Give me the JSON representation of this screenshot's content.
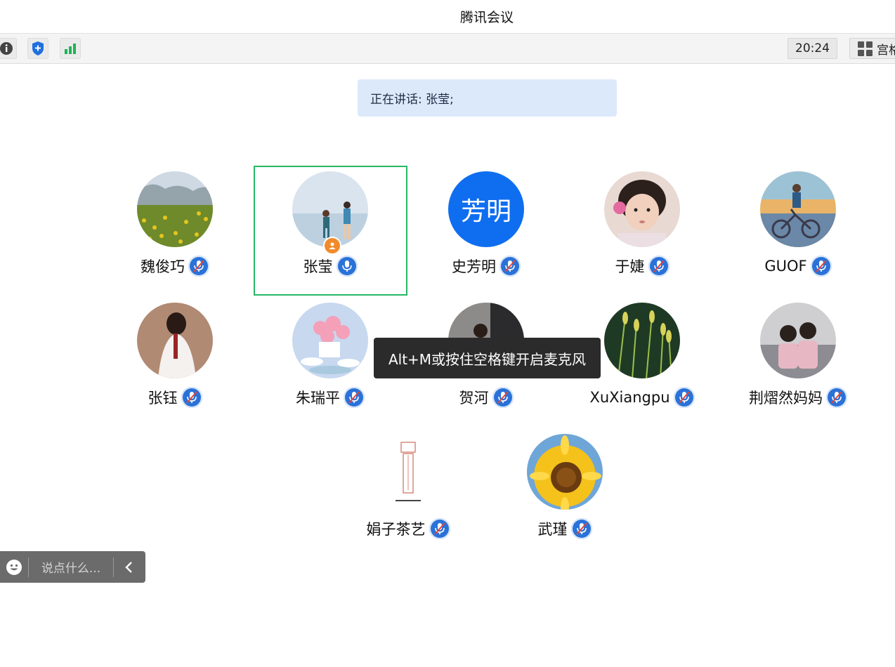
{
  "window": {
    "title": "腾讯会议"
  },
  "toolbar": {
    "info_icon": "info-icon",
    "shield_icon": "shield-icon",
    "signal_icon": "signal-icon",
    "time": "20:24",
    "view_label": "宫格",
    "view_icon": "grid-icon"
  },
  "speaking": {
    "text": "正在讲话: 张莹;"
  },
  "participants": [
    {
      "name": "魏俊巧",
      "mic": "muted",
      "avatar": "photo-meadow"
    },
    {
      "name": "张莹",
      "mic": "active",
      "avatar": "photo-beach-couple",
      "host": true,
      "speaking": true
    },
    {
      "name": "史芳明",
      "mic": "muted",
      "avatar": "text",
      "avatar_text": "芳明"
    },
    {
      "name": "于婕",
      "mic": "muted",
      "avatar": "photo-child"
    },
    {
      "name": "GUOF",
      "mic": "muted",
      "avatar": "photo-bicycle"
    },
    {
      "name": "张钰",
      "mic": "muted",
      "avatar": "photo-woman-field"
    },
    {
      "name": "朱瑞平",
      "mic": "muted",
      "avatar": "photo-flowers"
    },
    {
      "name": "贺河",
      "mic": "muted",
      "avatar": "photo-woman-door"
    },
    {
      "name": "XuXiangpu",
      "mic": "muted",
      "avatar": "photo-grass"
    },
    {
      "name": "荆熠然妈妈",
      "mic": "muted",
      "avatar": "photo-kids-sofa"
    },
    {
      "name": "娟子茶艺",
      "mic": "muted",
      "avatar": "seal-logo"
    },
    {
      "name": "武瑾",
      "mic": "muted",
      "avatar": "photo-sunflower"
    }
  ],
  "tooltip": {
    "text": "Alt+M或按住空格键开启麦克风"
  },
  "chat": {
    "placeholder": "说点什么...",
    "emoji_icon": "emoji-icon",
    "collapse_icon": "chevron-left-icon"
  },
  "colors": {
    "accent": "#2a72d8",
    "speaker_border": "#26b865",
    "banner_bg": "#dce9fb"
  }
}
